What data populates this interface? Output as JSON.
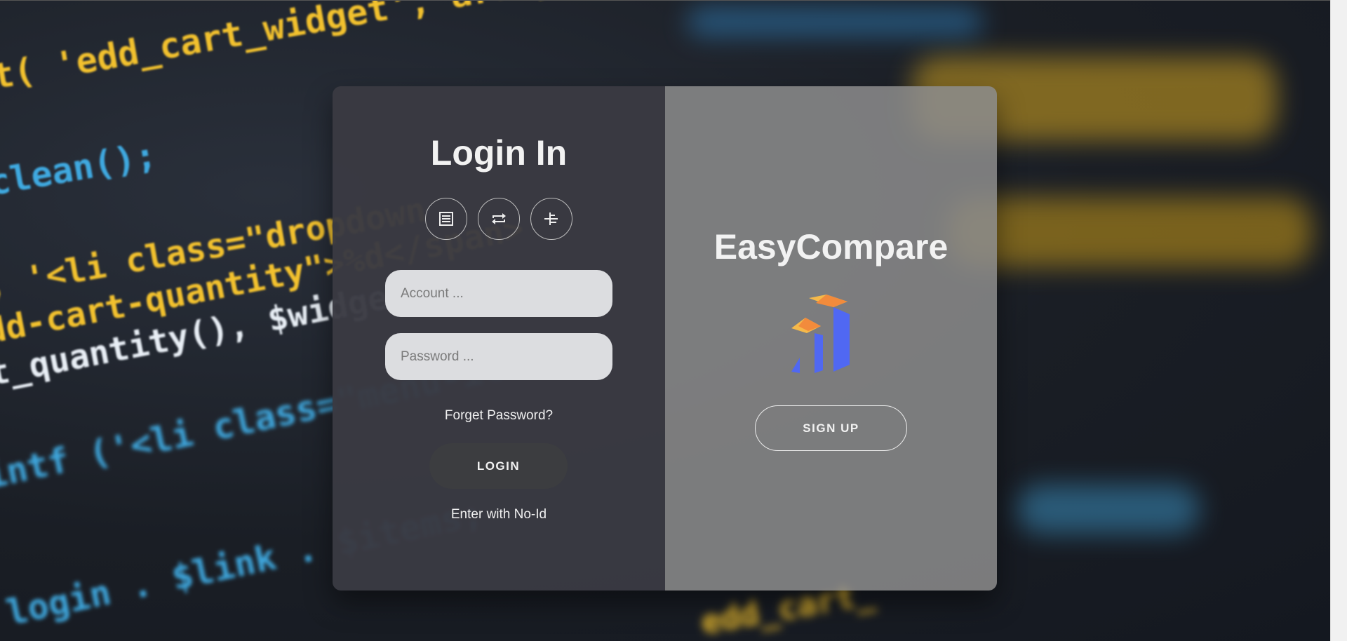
{
  "background": {
    "code_lines": [
      "t( 'edd_cart_widget', array(",
      "clean();",
      ", '<li class=\"dropdown",
      "dd-cart-quantity\">%d</span>",
      "t_quantity(), $widget );",
      "intf ('<li class=\"menu-item",
      "login . $link . $items;",
      "edd_cart_"
    ]
  },
  "login": {
    "title": "Login In",
    "social_icons": [
      "list-document-icon",
      "repeat-icon",
      "tree-align-icon"
    ],
    "account_placeholder": "Account ...",
    "password_placeholder": "Password ...",
    "forget_label": "Forget Password?",
    "login_label": "LOGIN",
    "no_id_label": "Enter with No-Id"
  },
  "signup": {
    "brand": "EasyCompare",
    "signup_label": "SIGN UP"
  },
  "colors": {
    "left_panel": "#3a3a42",
    "right_panel": "#8c8c8c",
    "logo_orange": "#f28b3c",
    "logo_yellow": "#f5b94a",
    "logo_blue": "#5068f2"
  }
}
